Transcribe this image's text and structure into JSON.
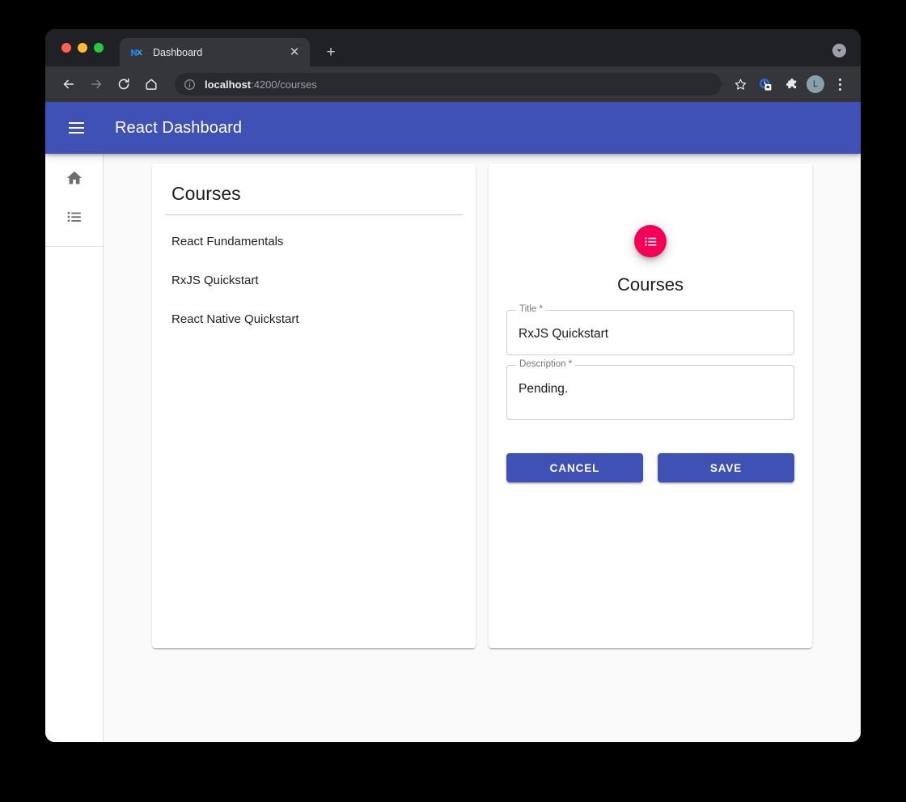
{
  "browser": {
    "tab": {
      "title": "Dashboard",
      "favicon_icon": "nx-logo-icon",
      "close_icon": "✕"
    },
    "new_tab_label": "+",
    "nav": {
      "back_icon": "←",
      "forward_icon": "→",
      "reload_icon": "⟳",
      "home_icon": "⌂"
    },
    "omnibox": {
      "info_icon": "info-circle-icon",
      "url_host": "localhost",
      "url_path": ":4200/courses"
    },
    "toolbar_icons": [
      {
        "name": "bookmark-star-icon"
      },
      {
        "name": "history-clock-icon"
      },
      {
        "name": "extensions-puzzle-icon"
      }
    ],
    "profile_initial": "L",
    "menu_icon": "kebab-menu-icon",
    "tabstrip_collapse_icon": "chevron-down-icon"
  },
  "app": {
    "header": {
      "menu_icon": "hamburger-menu-icon",
      "title": "React Dashboard"
    },
    "sidenav": {
      "items": [
        {
          "name": "home",
          "icon": "home-icon"
        },
        {
          "name": "courses-list",
          "icon": "list-icon"
        }
      ]
    },
    "list_card": {
      "header": "Courses",
      "courses": [
        "React Fundamentals",
        "RxJS Quickstart",
        "React Native Quickstart"
      ]
    },
    "form_card": {
      "avatar_icon": "list-icon",
      "title": "Courses",
      "fields": [
        {
          "label": "Title *",
          "value": "RxJS Quickstart"
        },
        {
          "label": "Description *",
          "value": "Pending."
        }
      ],
      "cancel_label": "CANCEL",
      "save_label": "SAVE"
    }
  },
  "colors": {
    "primary": "#3f51b5",
    "accent": "#f50057",
    "page_bg": "#fafafa",
    "chrome_bg": "#202124"
  }
}
